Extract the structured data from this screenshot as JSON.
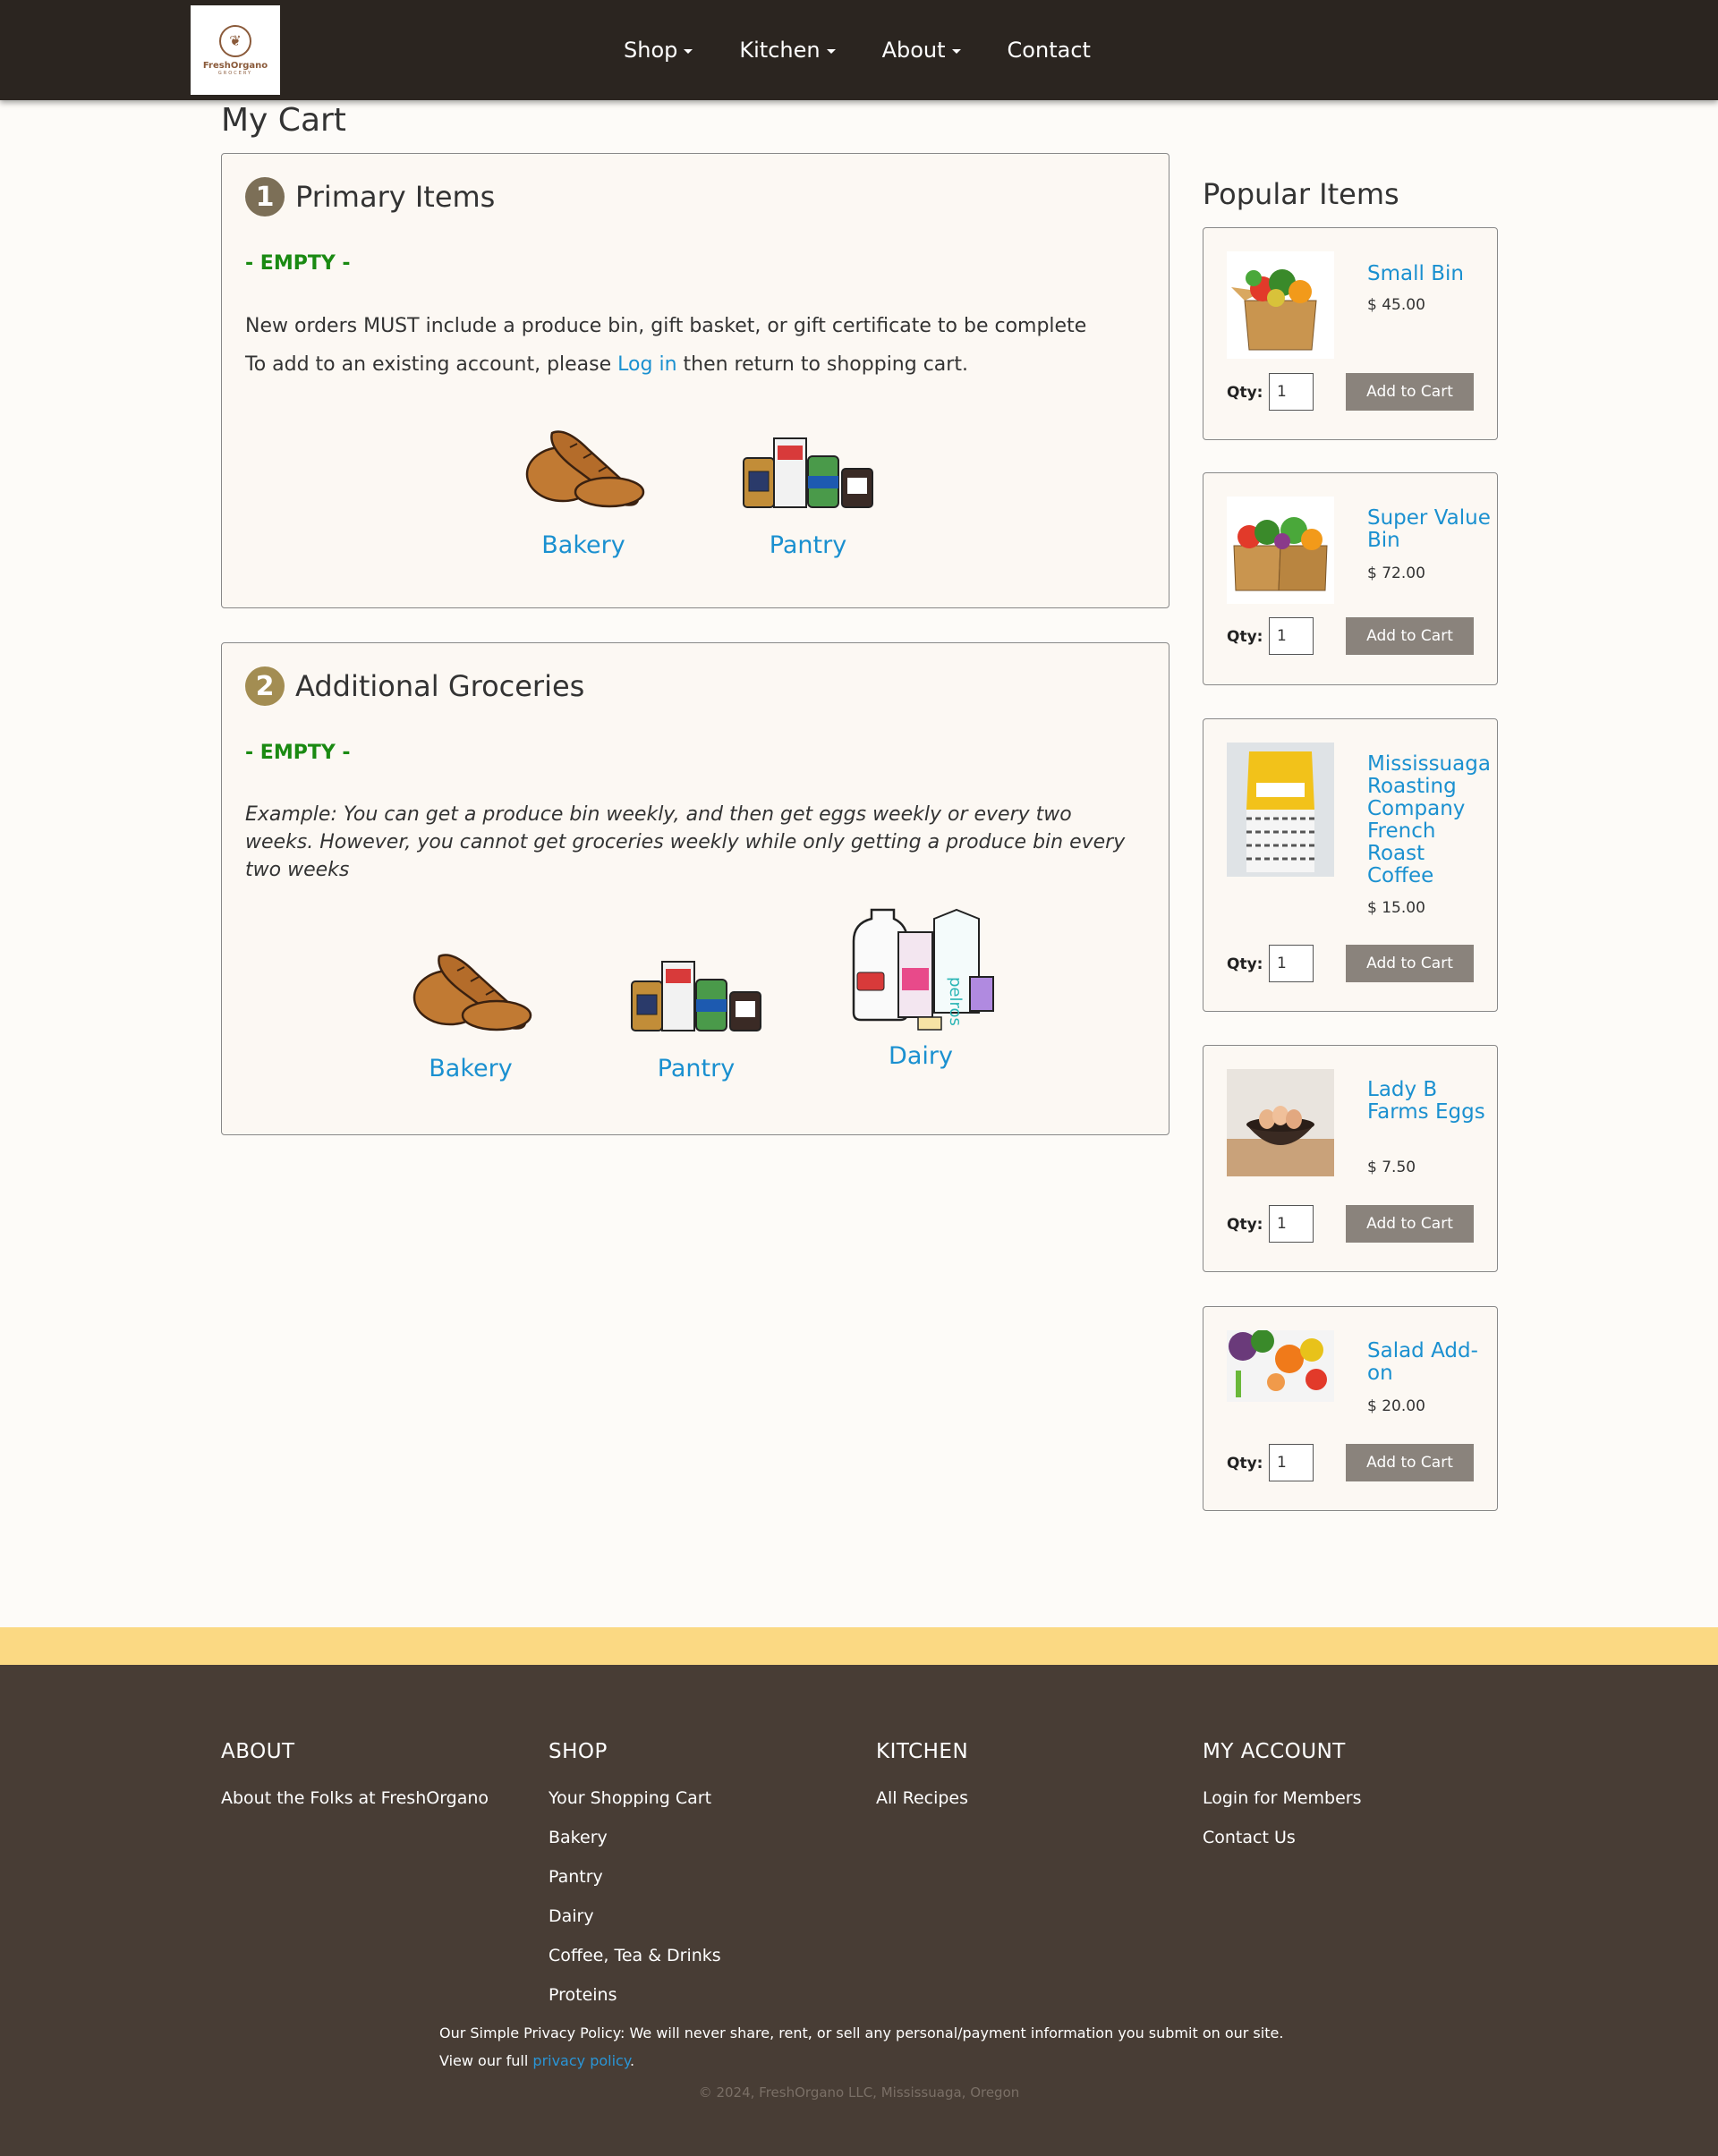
{
  "brand": {
    "name": "FreshOrgano",
    "sub": "GROCERY"
  },
  "nav": [
    {
      "label": "Shop",
      "dropdown": true
    },
    {
      "label": "Kitchen",
      "dropdown": true
    },
    {
      "label": "About",
      "dropdown": true
    },
    {
      "label": "Contact",
      "dropdown": false
    }
  ],
  "page_title": "My Cart",
  "primary": {
    "number": "1",
    "title": "Primary Items",
    "status": "- EMPTY -",
    "line1": "New orders MUST include a produce bin, gift basket, or gift certificate to be complete",
    "line2_before": "To add to an existing account, please",
    "line2_link": "Log in",
    "line2_after": "then return to shopping cart.",
    "categories": [
      {
        "label": "Bakery",
        "icon": "bread-icon"
      },
      {
        "label": "Pantry",
        "icon": "pantry-icon"
      }
    ]
  },
  "additional": {
    "number": "2",
    "title": "Additional Groceries",
    "status": "- EMPTY -",
    "example": "Example: You can get a produce bin weekly, and then get eggs weekly or every two weeks. However, you cannot get groceries weekly while only getting a produce bin every two weeks",
    "categories": [
      {
        "label": "Bakery",
        "icon": "bread-icon"
      },
      {
        "label": "Pantry",
        "icon": "pantry-icon"
      },
      {
        "label": "Dairy",
        "icon": "dairy-icon"
      }
    ]
  },
  "popular": {
    "title": "Popular Items",
    "qty_label": "Qty:",
    "button_label": "Add to Cart",
    "items": [
      {
        "name": "Small Bin",
        "price": "$ 45.00",
        "qty": "1"
      },
      {
        "name": "Super Value Bin",
        "price": "$ 72.00",
        "qty": "1"
      },
      {
        "name": "Mississuaga Roasting Company French Roast Coffee",
        "price": "$ 15.00",
        "qty": "1"
      },
      {
        "name": "Lady B Farms Eggs",
        "price": "$ 7.50",
        "qty": "1"
      },
      {
        "name": "Salad Add-on",
        "price": "$ 20.00",
        "qty": "1"
      }
    ]
  },
  "footer": {
    "about": {
      "title": "ABOUT",
      "links": [
        "About the Folks at FreshOrgano"
      ]
    },
    "shop": {
      "title": "SHOP",
      "links": [
        "Your Shopping Cart",
        "Bakery",
        "Pantry",
        "Dairy",
        "Coffee, Tea & Drinks",
        "Proteins"
      ]
    },
    "kitchen": {
      "title": "KITCHEN",
      "links": [
        "All Recipes"
      ]
    },
    "account": {
      "title": "MY ACCOUNT",
      "links": [
        "Login for Members",
        "Contact Us"
      ]
    },
    "privacy_line1": "Our Simple Privacy Policy: We will never share, rent, or sell any personal/payment information you submit on our site.",
    "privacy_line2_before": "View our full",
    "privacy_link": "privacy policy",
    "privacy_line2_after": ".",
    "copyright": "© 2024, FreshOrgano LLC, Mississuaga, Oregon"
  },
  "colors": {
    "header": "#2b2520",
    "footer": "#483d35",
    "stripe": "#fbd983",
    "link": "#1a90d0",
    "empty": "#1a8a12",
    "button": "#8a837c"
  }
}
